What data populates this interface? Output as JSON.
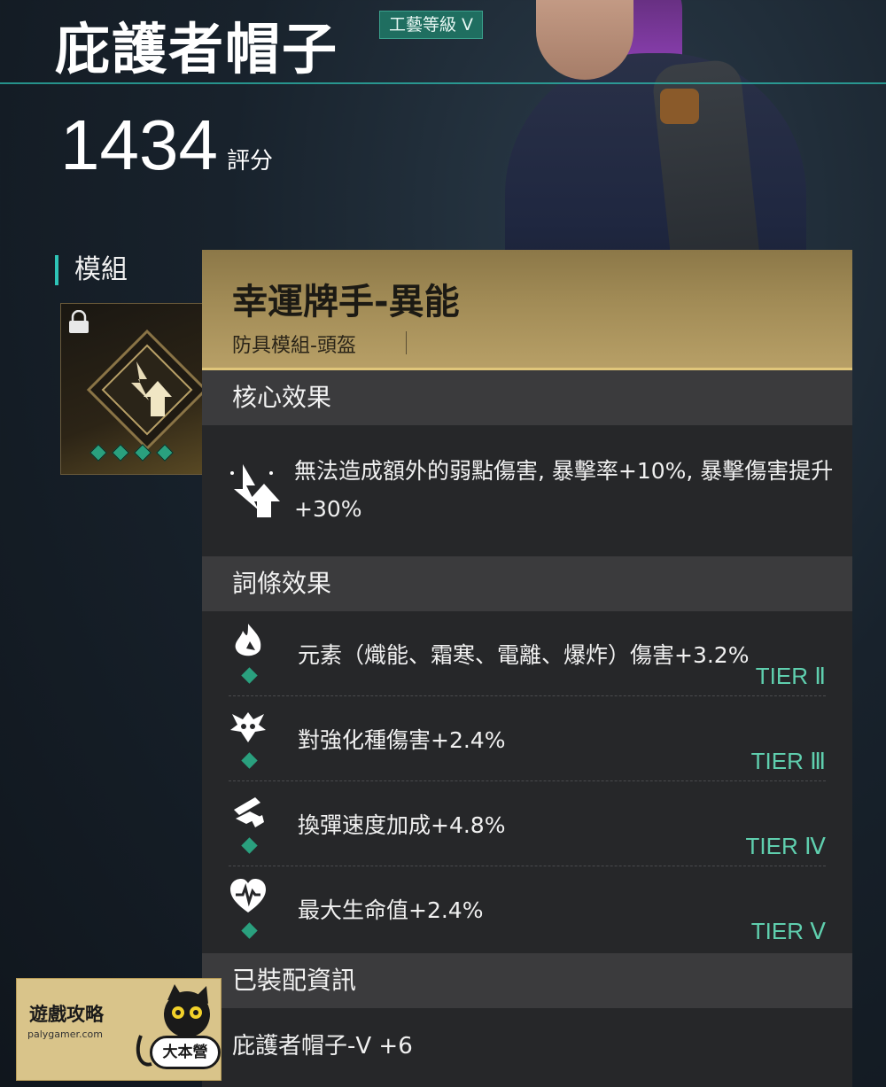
{
  "header": {
    "item_name": "庇護者帽子",
    "craft_level": "工藝等級 V",
    "score_value": "1434",
    "score_unit": "評分"
  },
  "modules": {
    "label": "模組",
    "slot_icon": "lightning-arrow-icon",
    "level_dots": 4
  },
  "tooltip": {
    "name": "幸運牌手-異能",
    "type": "防具模組-頭盔",
    "core": {
      "title": "核心效果",
      "icon": "lightning-arrow-icon",
      "text": "無法造成額外的弱點傷害, 暴擊率+10%, 暴擊傷害提升+30%"
    },
    "affixes": {
      "title": "詞條效果",
      "items": [
        {
          "icon": "elemental-icon",
          "text": "元素（熾能、霜寒、電離、爆炸）傷害+3.2%",
          "tier": "TIER Ⅱ"
        },
        {
          "icon": "enemy-icon",
          "text": "對強化種傷害+2.4%",
          "tier": "TIER Ⅲ"
        },
        {
          "icon": "reload-icon",
          "text": "換彈速度加成+4.8%",
          "tier": "TIER Ⅳ"
        },
        {
          "icon": "heart-icon",
          "text": "最大生命值+2.4%",
          "tier": "TIER Ⅴ"
        }
      ]
    },
    "equipped": {
      "title": "已裝配資訊",
      "text": "庇護者帽子-V +6"
    }
  },
  "watermark": {
    "title": "遊戲攻略",
    "url": "palygamer.com",
    "badge": "大本營"
  },
  "colors": {
    "accent": "#2ec4b6",
    "gold": "#b8a067",
    "tier": "#5fcfae",
    "gem": "#2aa07e"
  }
}
